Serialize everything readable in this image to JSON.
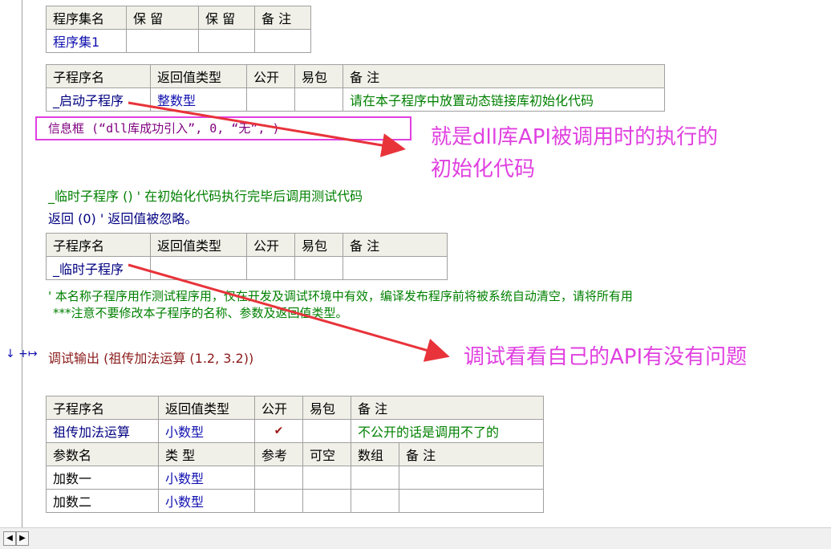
{
  "assembly_table": {
    "headers": [
      "程序集名",
      "保 留",
      "保 留",
      "备 注"
    ],
    "row": [
      "程序集1",
      "",
      "",
      ""
    ]
  },
  "startup_sub_table": {
    "headers": [
      "子程序名",
      "返回值类型",
      "公开",
      "易包",
      "备 注"
    ],
    "row": [
      "_启动子程序",
      "整数型",
      "",
      "",
      "请在本子程序中放置动态链接库初始化代码"
    ]
  },
  "code_line_msgbox": "信息框 (“dll库成功引入”, 0, “无”, )",
  "annotation_1_line1": "就是dll库API被调用时的执行的",
  "annotation_1_line2": "初始化代码",
  "code_temp_sub": "_临时子程序 ()  ' 在初始化代码执行完毕后调用测试代码",
  "code_return": "返回 (0)  ' 返回值被忽略。",
  "temp_sub_table": {
    "headers": [
      "子程序名",
      "返回值类型",
      "公开",
      "易包",
      "备 注"
    ],
    "row": [
      "_临时子程序",
      "",
      "",
      "",
      ""
    ]
  },
  "comment_line1": "' 本名称子程序用作测试程序用，仅在开发及调试环境中有效，编译发布程序前将被系统自动清空，请将所有用",
  "comment_line2": "***注意不要修改本子程序的名称、参数及返回值类型。",
  "gutter_markers": "↓ +↦",
  "debug_call": "调试输出 (祖传加法运算 (1.2, 3.2))",
  "annotation_2": "调试看看自己的API有没有问题",
  "add_sub_table": {
    "headers": [
      "子程序名",
      "返回值类型",
      "公开",
      "易包",
      "备 注"
    ],
    "row": [
      "祖传加法运算",
      "小数型",
      "✔",
      "",
      "不公开的话是调用不了的"
    ],
    "param_headers": [
      "参数名",
      "类 型",
      "参考",
      "可空",
      "数组",
      "备 注"
    ],
    "params": [
      [
        "加数一",
        "小数型",
        "",
        "",
        "",
        ""
      ],
      [
        "加数二",
        "小数型",
        "",
        "",
        "",
        ""
      ]
    ]
  },
  "colors": {
    "annotation": "#e040e0",
    "arrow": "#e8333a",
    "header_bg": "#f0f0e8",
    "border": "#a0a0a0"
  },
  "scrollbar": {
    "left_icon": "scroll-left-icon",
    "right_icon": "scroll-right-icon",
    "left_glyph": "◀",
    "right_glyph": "▶"
  }
}
